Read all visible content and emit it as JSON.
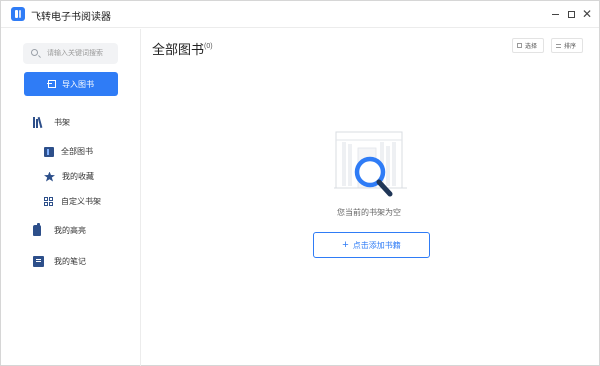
{
  "window": {
    "title": "飞转电子书阅读器",
    "controls": {
      "minimize": "–",
      "maximize": "□",
      "close": "✕"
    }
  },
  "sidebar": {
    "search": {
      "placeholder": "请输入关键词搜索",
      "value": ""
    },
    "import_button": "导入图书",
    "items": [
      {
        "label": "书架",
        "icon": "bookshelf-icon"
      },
      {
        "label": "全部图书",
        "icon": "all-books-icon"
      },
      {
        "label": "我的收藏",
        "icon": "star-icon"
      },
      {
        "label": "自定义书架",
        "icon": "grid-icon"
      },
      {
        "label": "我的高亮",
        "icon": "highlight-icon"
      },
      {
        "label": "我的笔记",
        "icon": "note-icon"
      }
    ]
  },
  "main": {
    "title": "全部图书",
    "count": "(0)",
    "toolbar": {
      "select_label": "选择",
      "sort_label": "排序"
    },
    "empty_state": {
      "message": "您当前的书架为空",
      "add_button_icon": "+",
      "add_button_label": "点击添加书籍"
    }
  },
  "colors": {
    "accent": "#2f7cf6",
    "icon_dark": "#2d4f8a",
    "search_bg": "#f2f3f5"
  }
}
